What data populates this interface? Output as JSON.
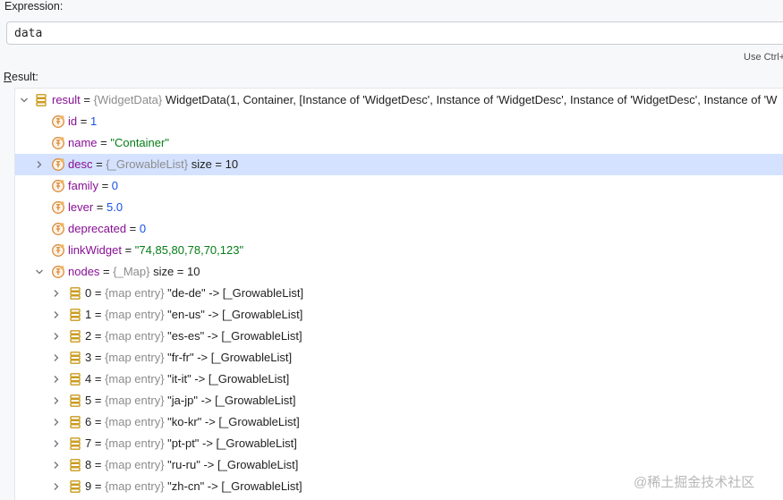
{
  "expression": {
    "label": "Expression:",
    "value": "data",
    "hint": "Use Ctrl+"
  },
  "result": {
    "label_underline": "R",
    "label_rest": "esult:",
    "root": {
      "name": "result",
      "type": "{WidgetData}",
      "value": "WidgetData(1, Container, [Instance of 'WidgetDesc', Instance of 'WidgetDesc', Instance of 'WidgetDesc', Instance of 'W"
    },
    "fields": [
      {
        "name": "id",
        "value": "1",
        "kind": "num"
      },
      {
        "name": "name",
        "value": "\"Container\"",
        "kind": "str"
      },
      {
        "name": "desc",
        "type": "{_GrowableList}",
        "value": "size = 10",
        "kind": "plain",
        "expandable": true,
        "selected": true
      },
      {
        "name": "family",
        "value": "0",
        "kind": "num"
      },
      {
        "name": "lever",
        "value": "5.0",
        "kind": "num"
      },
      {
        "name": "deprecated",
        "value": "0",
        "kind": "num"
      },
      {
        "name": "linkWidget",
        "value": "\"74,85,80,78,70,123\"",
        "kind": "str"
      }
    ],
    "nodes": {
      "name": "nodes",
      "type": "{_Map}",
      "value": "size = 10",
      "entries": [
        {
          "index": "0",
          "type": "{map entry}",
          "key": "\"de-de\"",
          "value": "-> [_GrowableList]"
        },
        {
          "index": "1",
          "type": "{map entry}",
          "key": "\"en-us\"",
          "value": "-> [_GrowableList]"
        },
        {
          "index": "2",
          "type": "{map entry}",
          "key": "\"es-es\"",
          "value": "-> [_GrowableList]"
        },
        {
          "index": "3",
          "type": "{map entry}",
          "key": "\"fr-fr\"",
          "value": "-> [_GrowableList]"
        },
        {
          "index": "4",
          "type": "{map entry}",
          "key": "\"it-it\"",
          "value": "-> [_GrowableList]"
        },
        {
          "index": "5",
          "type": "{map entry}",
          "key": "\"ja-jp\"",
          "value": "-> [_GrowableList]"
        },
        {
          "index": "6",
          "type": "{map entry}",
          "key": "\"ko-kr\"",
          "value": "-> [_GrowableList]"
        },
        {
          "index": "7",
          "type": "{map entry}",
          "key": "\"pt-pt\"",
          "value": "-> [_GrowableList]"
        },
        {
          "index": "8",
          "type": "{map entry}",
          "key": "\"ru-ru\"",
          "value": "-> [_GrowableList]"
        },
        {
          "index": "9",
          "type": "{map entry}",
          "key": "\"zh-cn\"",
          "value": "-> [_GrowableList]"
        }
      ]
    }
  },
  "watermark": "@稀土掘金技术社区",
  "colors": {
    "field_name": "#871094",
    "type_hint": "#8c8c8c",
    "string": "#067d17",
    "number": "#1750eb",
    "selection": "#d4e2ff",
    "object_icon": "#c99a1c",
    "field_icon": "#d98a3c"
  },
  "icons": {
    "expand": "chevron-right-icon",
    "collapse": "chevron-down-icon",
    "object": "object-stack-icon",
    "field": "field-icon"
  }
}
